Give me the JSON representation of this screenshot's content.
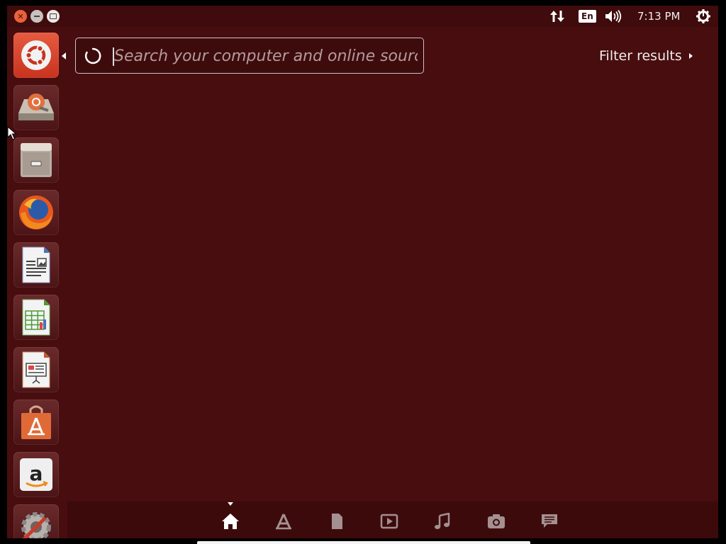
{
  "top_panel": {
    "keyboard_layout": "En",
    "clock": "7:13 PM"
  },
  "search": {
    "placeholder": "Search your computer and online sources",
    "value": ""
  },
  "filter": {
    "label": "Filter results"
  },
  "launcher": {
    "items": [
      {
        "name": "dash-home-button",
        "icon": "ubuntu-logo-icon"
      },
      {
        "name": "ubuntu-one-installer",
        "icon": "installer-icon"
      },
      {
        "name": "files",
        "icon": "file-cabinet-icon"
      },
      {
        "name": "firefox",
        "icon": "firefox-icon"
      },
      {
        "name": "libreoffice-writer",
        "icon": "writer-icon"
      },
      {
        "name": "libreoffice-calc",
        "icon": "calc-icon"
      },
      {
        "name": "libreoffice-impress",
        "icon": "impress-icon"
      },
      {
        "name": "software-center",
        "icon": "shopping-bag-icon"
      },
      {
        "name": "amazon",
        "icon": "amazon-icon"
      },
      {
        "name": "system-settings",
        "icon": "settings-icon"
      }
    ]
  },
  "lenses": [
    {
      "name": "home",
      "icon": "home-icon",
      "active": true
    },
    {
      "name": "applications",
      "icon": "applications-icon"
    },
    {
      "name": "files",
      "icon": "file-icon"
    },
    {
      "name": "video",
      "icon": "video-icon"
    },
    {
      "name": "music",
      "icon": "music-icon"
    },
    {
      "name": "photos",
      "icon": "camera-icon"
    },
    {
      "name": "social",
      "icon": "chat-icon"
    }
  ],
  "colors": {
    "dash_background": "#470d0f",
    "accent": "#e05a3c"
  }
}
